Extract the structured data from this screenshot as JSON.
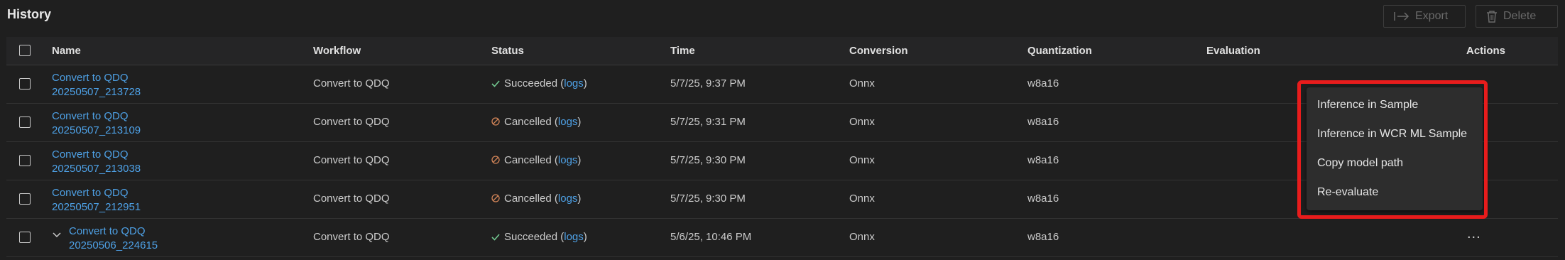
{
  "header": {
    "title": "History",
    "export_label": "Export",
    "delete_label": "Delete"
  },
  "table": {
    "columns": [
      "Name",
      "Workflow",
      "Status",
      "Time",
      "Conversion",
      "Quantization",
      "Evaluation",
      "Actions"
    ],
    "rows": [
      {
        "name_line1": "Convert to QDQ",
        "name_line2": "20250507_213728",
        "workflow": "Convert to QDQ",
        "status": "Succeeded",
        "status_icon": "check-icon",
        "logs": "logs",
        "time": "5/7/25, 9:37 PM",
        "conversion": "Onnx",
        "quantization": "w8a16"
      },
      {
        "name_line1": "Convert to QDQ",
        "name_line2": "20250507_213109",
        "workflow": "Convert to QDQ",
        "status": "Cancelled",
        "status_icon": "cancelled-icon",
        "logs": "logs",
        "time": "5/7/25, 9:31 PM",
        "conversion": "Onnx",
        "quantization": "w8a16"
      },
      {
        "name_line1": "Convert to QDQ",
        "name_line2": "20250507_213038",
        "workflow": "Convert to QDQ",
        "status": "Cancelled",
        "status_icon": "cancelled-icon",
        "logs": "logs",
        "time": "5/7/25, 9:30 PM",
        "conversion": "Onnx",
        "quantization": "w8a16"
      },
      {
        "name_line1": "Convert to QDQ",
        "name_line2": "20250507_212951",
        "workflow": "Convert to QDQ",
        "status": "Cancelled",
        "status_icon": "cancelled-icon",
        "logs": "logs",
        "time": "5/7/25, 9:30 PM",
        "conversion": "Onnx",
        "quantization": "w8a16"
      },
      {
        "name_line1": "Convert to QDQ",
        "name_line2": "20250506_224615",
        "workflow": "Convert to QDQ",
        "status": "Succeeded",
        "status_icon": "check-icon",
        "logs": "logs",
        "time": "5/6/25, 10:46 PM",
        "conversion": "Onnx",
        "quantization": "w8a16",
        "expand_icon": "chevron-down-icon",
        "actions": "..."
      }
    ]
  },
  "context_menu": {
    "items": [
      "Inference in Sample",
      "Inference in WCR ML Sample",
      "Copy model path",
      "Re-evaluate"
    ]
  },
  "colors": {
    "background": "#1f1f1f",
    "link": "#4ea1e6",
    "success": "#73c991",
    "cancelled": "#d18458",
    "highlight": "#e81c1c"
  }
}
